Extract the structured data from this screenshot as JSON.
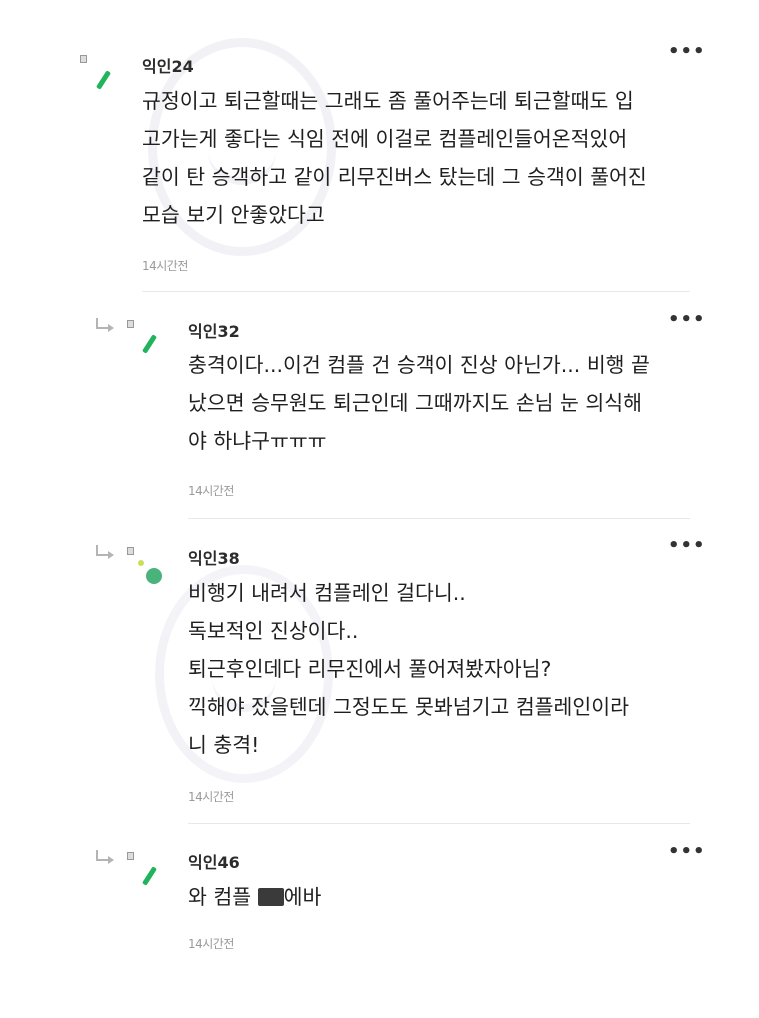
{
  "comments": [
    {
      "nickname": "익인24",
      "lines": [
        "규정이고 퇴근할때는 그래도 좀 풀어주는데 퇴근할때도 입",
        "고가는게 좋다는 식임 전에 이걸로 컴플레인들어온적있어",
        "같이 탄 승객하고 같이 리무진버스 탔는데 그 승객이 풀어진",
        "모습 보기 안좋았다고"
      ],
      "time": "14시간전",
      "more": "•••"
    },
    {
      "nickname": "익인32",
      "lines": [
        "충격이다...이건 컴플 건 승객이 진상 아닌가... 비행 끝",
        "났으면 승무원도 퇴근인데 그때까지도 손님 눈 의식해",
        "야 하냐구ㅠㅠㅠ"
      ],
      "time": "14시간전",
      "more": "•••"
    },
    {
      "nickname": "익인38",
      "lines": [
        "비행기 내려서 컴플레인 걸다니..",
        "독보적인 진상이다..",
        "퇴근후인데다 리무진에서 풀어져봤자아님?",
        "끽해야 잤을텐데 그정도도 못봐넘기고 컴플레인이라",
        "니 충격!"
      ],
      "time": "14시간전",
      "more": "•••"
    },
    {
      "nickname": "익인46",
      "text_before": "와 컴플 ",
      "text_after": "에바",
      "time": "14시간전",
      "more": "•••"
    }
  ]
}
